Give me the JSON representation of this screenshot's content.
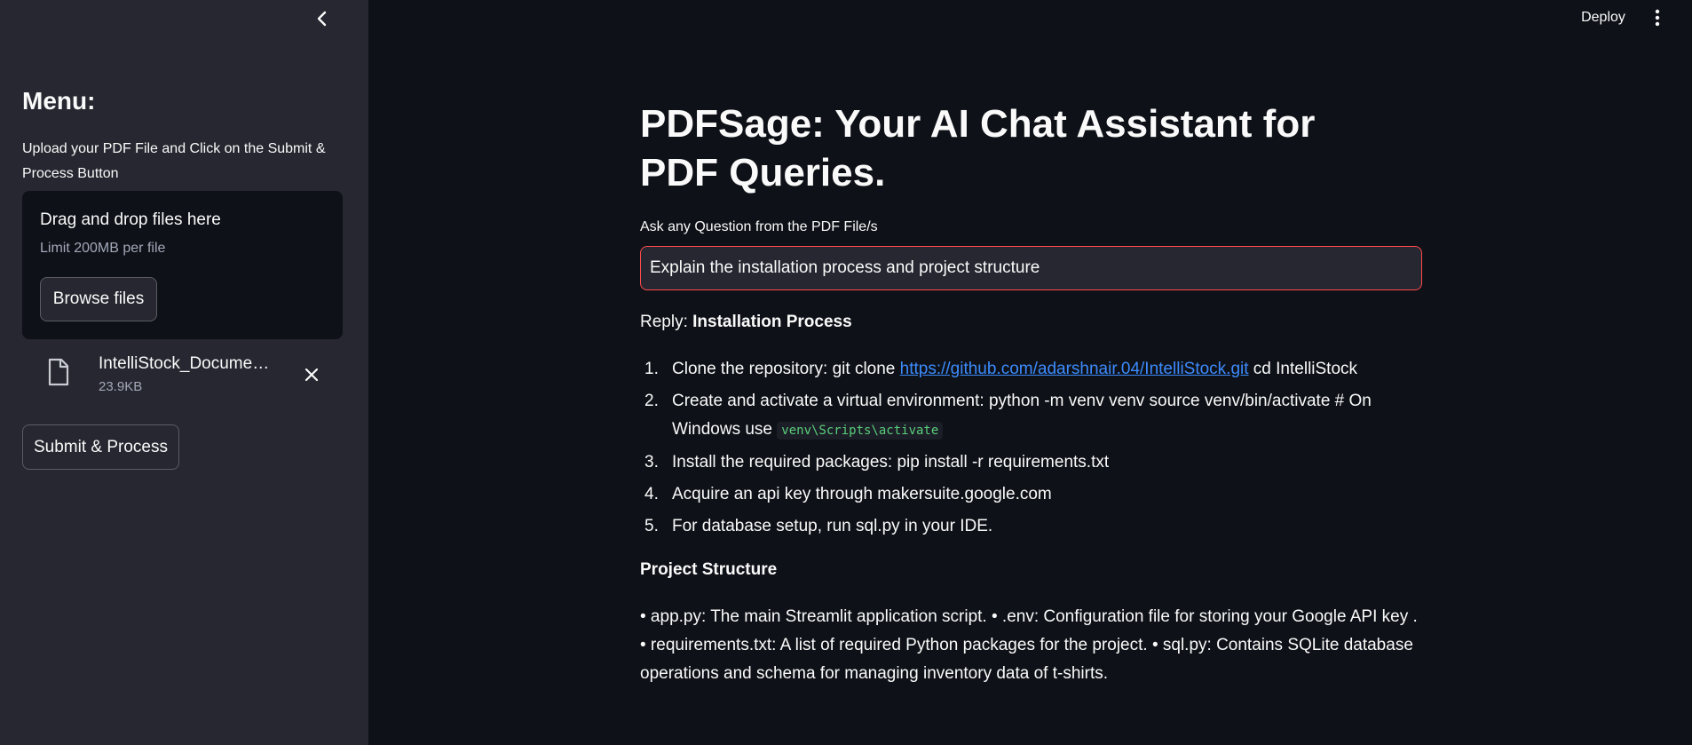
{
  "sidebar": {
    "collapse_icon": "chevron-left-icon",
    "menu_title": "Menu:",
    "description": "Upload your PDF File and Click on the Submit & Process Button",
    "uploader": {
      "drag_text": "Drag and drop files here",
      "limit_text": "Limit 200MB per file",
      "browse_label": "Browse files"
    },
    "file": {
      "name": "IntelliStock_Documentat…",
      "size": "23.9KB"
    },
    "submit_label": "Submit & Process"
  },
  "header": {
    "deploy_label": "Deploy",
    "menu_icon": "kebab-menu-icon"
  },
  "main": {
    "title": "PDFSage: Your AI Chat Assistant for PDF Queries.",
    "question_label": "Ask any Question from the PDF File/s",
    "question_value": "Explain the installation process and project structure",
    "reply_prefix": "Reply: ",
    "reply_heading": "Installation Process",
    "steps": [
      {
        "num": "1.",
        "text_before": "Clone the repository: git clone ",
        "link": "https://github.com/adarshnair.04/IntelliStock.git",
        "text_after": " cd IntelliStock"
      },
      {
        "num": "2.",
        "text_before": "Create and activate a virtual environment: python -m venv venv source venv/bin/activate # On Windows use ",
        "code": "venv\\Scripts\\activate"
      },
      {
        "num": "3.",
        "text_before": "Install the required packages: pip install -r requirements.txt"
      },
      {
        "num": "4.",
        "text_before": "Acquire an api key through makersuite.google.com"
      },
      {
        "num": "5.",
        "text_before": "For database setup, run sql.py in your IDE."
      }
    ],
    "project_heading": "Project Structure",
    "project_body": "• app.py: The main Streamlit application script. • .env: Configuration file for storing your Google API key . • requirements.txt: A list of required Python packages for the project. • sql.py: Contains SQLite database operations and schema for managing inventory data of t-shirts."
  },
  "colors": {
    "background": "#0e1117",
    "sidebar": "#262730",
    "accent_border": "#ff4b4b",
    "link": "#3d8bfd",
    "code": "#5ace7b"
  }
}
